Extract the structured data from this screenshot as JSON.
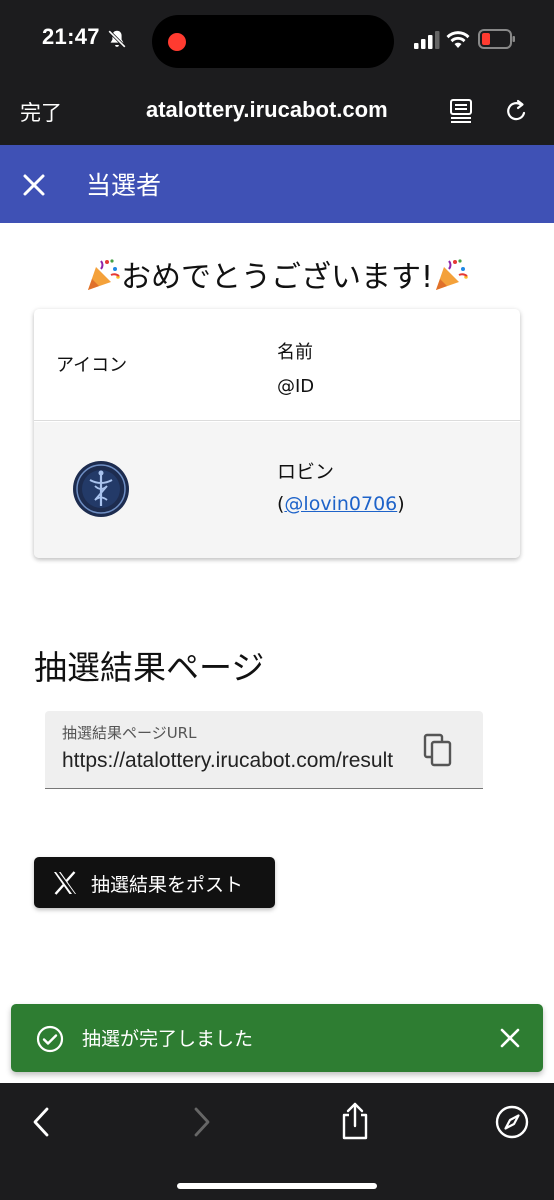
{
  "status_bar": {
    "time": "21:47",
    "icons": [
      "bell-slash-icon",
      "signal-icon",
      "wifi-icon",
      "battery-low-icon"
    ],
    "battery_color": "#ff3b30"
  },
  "browser": {
    "done_label": "完了",
    "url": "atalottery.irucabot.com",
    "icons": [
      "reader-icon",
      "reload-icon",
      "back-icon",
      "forward-icon",
      "share-icon",
      "compass-icon"
    ]
  },
  "app_bar": {
    "title": "当選者",
    "close_icon": "close-icon",
    "color": "#3f51b5"
  },
  "congrats": {
    "text": "おめでとうございます!",
    "icon": "party-popper-icon"
  },
  "winners_table": {
    "headers": {
      "icon": "アイコン",
      "name": "名前",
      "id": "@ID"
    },
    "rows": [
      {
        "name": "ロビン",
        "id_open": "(",
        "id": "@lovin0706",
        "id_close": ")",
        "avatar_icon": "caduceus-emblem-icon"
      }
    ]
  },
  "result_page": {
    "title": "抽選結果ページ",
    "field_label": "抽選結果ページURL",
    "field_value": "https://atalottery.irucabot.com/result",
    "copy_icon": "copy-icon"
  },
  "post_button": {
    "label": "抽選結果をポスト",
    "icon": "x-logo-icon"
  },
  "snackbar": {
    "message": "抽選が完了しました",
    "icon": "check-circle-icon",
    "close_icon": "close-icon",
    "color": "#2e7d32"
  }
}
